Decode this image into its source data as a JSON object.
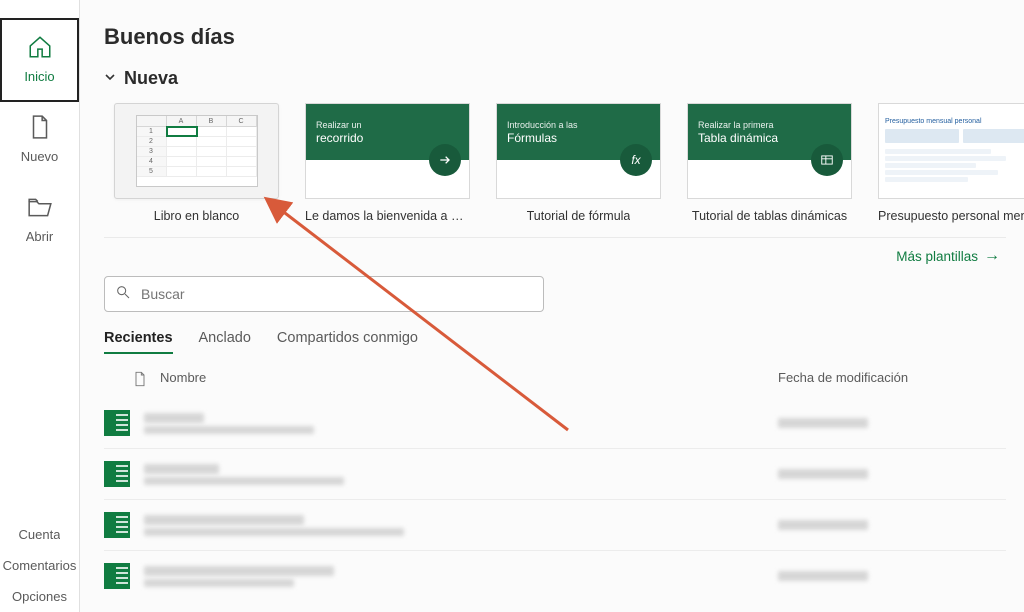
{
  "greeting": "Buenos días",
  "sidebar": {
    "items": [
      {
        "label": "Inicio"
      },
      {
        "label": "Nuevo"
      },
      {
        "label": "Abrir"
      }
    ],
    "bottom": [
      {
        "label": "Cuenta"
      },
      {
        "label": "Comentarios"
      },
      {
        "label": "Opciones"
      }
    ]
  },
  "section_new": "Nueva",
  "templates": [
    {
      "caption": "Libro en blanco"
    },
    {
      "caption": "Le damos la bienvenida a Ex…",
      "pre": "Realizar un",
      "main": "recorrido"
    },
    {
      "caption": "Tutorial de fórmula",
      "pre": "Introducción a las",
      "main": "Fórmulas"
    },
    {
      "caption": "Tutorial de tablas dinámicas",
      "pre": "Realizar la primera",
      "main": "Tabla dinámica"
    },
    {
      "caption": "Presupuesto personal mensual",
      "doc_title": "Presupuesto mensual personal"
    }
  ],
  "more_templates": "Más plantillas",
  "search": {
    "placeholder": "Buscar"
  },
  "tabs": [
    {
      "label": "Recientes"
    },
    {
      "label": "Anclado"
    },
    {
      "label": "Compartidos conmigo"
    }
  ],
  "file_columns": {
    "name": "Nombre",
    "date": "Fecha de modificación"
  },
  "recent_count": 4,
  "doc_icon_text": "D"
}
